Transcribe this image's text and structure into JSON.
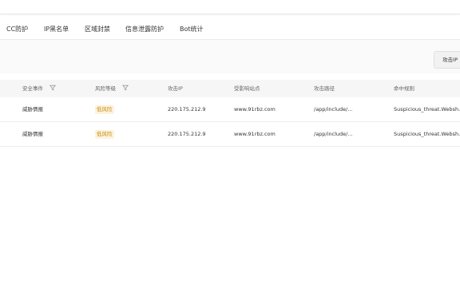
{
  "tabs": [
    "CC防护",
    "IP黑名单",
    "区域封禁",
    "信息泄露防护",
    "Bot统计"
  ],
  "toolbar": {
    "button_label": "攻击IP"
  },
  "table": {
    "columns": [
      "安全事件",
      "风险等级",
      "攻击IP",
      "受影响站点",
      "攻击路径",
      "命中规则"
    ],
    "rows": [
      {
        "event": "威胁情报",
        "risk": "低风险",
        "ip": "220.175.212.9",
        "site": "www.91rbz.com",
        "path": "/app/include/...",
        "rule": "Suspicious_threat.Websh..."
      },
      {
        "event": "威胁情报",
        "risk": "低风险",
        "ip": "220.175.212.9",
        "site": "www.91rbz.com",
        "path": "/app/include/...",
        "rule": "Suspicious_threat.Websh..."
      }
    ]
  },
  "colors": {
    "risk_low_bg": "#fdf3dc",
    "risk_low_text": "#c98c15"
  }
}
